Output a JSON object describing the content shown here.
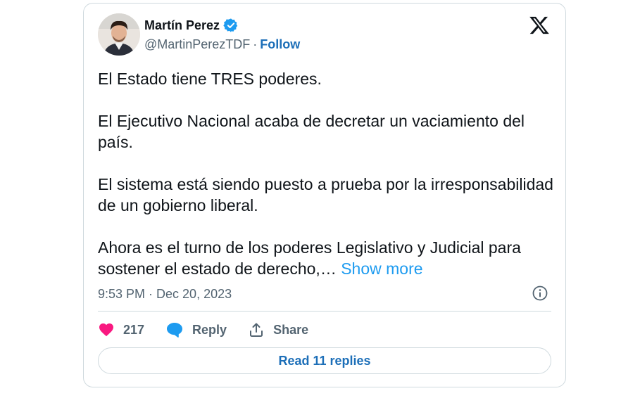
{
  "author": {
    "display_name": "Martín Perez",
    "handle": "@MartinPerezTDF",
    "separator": "·",
    "follow_label": "Follow",
    "verified": true
  },
  "icons": {
    "verified": "verified-badge-icon",
    "brand": "x-logo-icon",
    "info": "info-icon",
    "like": "heart-icon",
    "reply": "speech-bubble-icon",
    "share": "share-upload-icon"
  },
  "tweet": {
    "paragraphs": [
      "El Estado tiene TRES poderes.",
      "El Ejecutivo Nacional acaba de decretar un vaciamiento del país.",
      "El sistema está siendo puesto a prueba por la irresponsabilidad de un gobierno liberal.",
      "Ahora es el turno de los poderes Legislativo y Judicial para sostener el estado de derecho,…"
    ],
    "show_more_label": "Show more",
    "timestamp": "9:53 PM · Dec 20, 2023"
  },
  "actions": {
    "like_count": "217",
    "reply_label": "Reply",
    "share_label": "Share",
    "read_replies_label": "Read 11 replies"
  },
  "colors": {
    "like": "#f91880",
    "reply": "#1d9bf0",
    "link": "#1d6fb8",
    "verified": "#1d9bf0",
    "muted": "#536471",
    "border": "#cfd9de"
  }
}
